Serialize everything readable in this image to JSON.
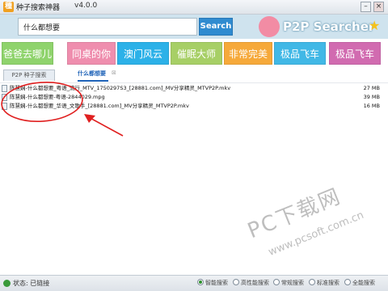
{
  "window": {
    "title": "种子搜索神器",
    "version": "v4.0.0"
  },
  "search": {
    "value": "什么都想要",
    "button_label": "Search"
  },
  "brand": {
    "label": "P2P Searcher"
  },
  "categories": [
    {
      "label": "爸爸去哪儿",
      "color": "#8fd36c"
    },
    {
      "label": "同桌的你",
      "color": "#ef8eae"
    },
    {
      "label": "澳门风云",
      "color": "#2cb1e8"
    },
    {
      "label": "催眠大师",
      "color": "#a7cf66"
    },
    {
      "label": "非常完美",
      "color": "#f6a93a"
    },
    {
      "label": "极品飞车",
      "color": "#41b8e6"
    },
    {
      "label": "极品飞车",
      "color": "#d16bb0"
    }
  ],
  "tabs": {
    "p2p_label": "P2P 种子搜索",
    "current_label": "什么都想要",
    "close_label": "⊠"
  },
  "results": [
    {
      "name": "陈慧娴-什么都想要_粤语_流行_MTV_1750297S3_[28881.com]_MV分享精灵_MTVP2P.mkv",
      "size": "27 MB"
    },
    {
      "name": "陈慧娴-什么都想要-粤语-2844029.mpg",
      "size": "39 MB"
    },
    {
      "name": "陈慧娴-什么都想要_华语_文歌手_[28881.com]_MV分享精灵_MTVP2P.mkv",
      "size": "16 MB"
    }
  ],
  "watermark": {
    "main": "PC下载网",
    "url": "www.pcsoft.com.cn"
  },
  "status": {
    "text": "状态: 已链接"
  },
  "modes": [
    {
      "label": "智能搜索",
      "selected": true
    },
    {
      "label": "高性能搜索",
      "selected": false
    },
    {
      "label": "常规搜索",
      "selected": false
    },
    {
      "label": "标准搜索",
      "selected": false
    },
    {
      "label": "全能搜索",
      "selected": false
    }
  ],
  "colors": {
    "accent": "#2f8bd0",
    "annotation": "#e02020"
  }
}
